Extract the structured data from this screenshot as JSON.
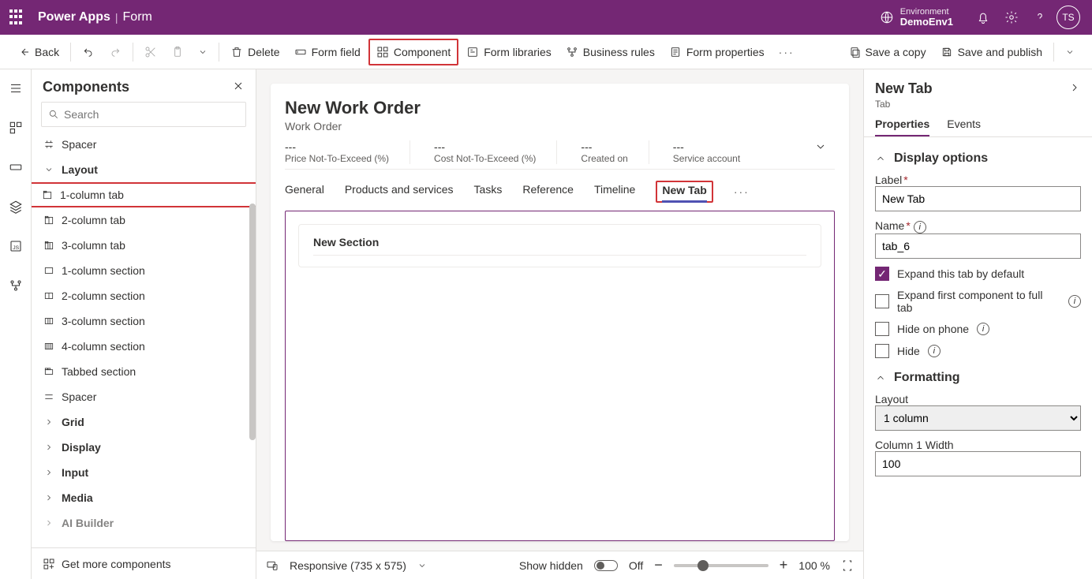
{
  "topbar": {
    "brand": "Power Apps",
    "subbrand": "Form",
    "env_label": "Environment",
    "env_name": "DemoEnv1",
    "avatar": "TS"
  },
  "cmdbar": {
    "back": "Back",
    "delete": "Delete",
    "form_field": "Form field",
    "component": "Component",
    "form_libraries": "Form libraries",
    "business_rules": "Business rules",
    "form_properties": "Form properties",
    "save_copy": "Save a copy",
    "save_publish": "Save and publish"
  },
  "components": {
    "title": "Components",
    "search_placeholder": "Search",
    "footer": "Get more components",
    "items": [
      {
        "label": "Spacer",
        "type": "item"
      },
      {
        "label": "Layout",
        "type": "group"
      },
      {
        "label": "1-column tab",
        "type": "item",
        "highlight": true
      },
      {
        "label": "2-column tab",
        "type": "item"
      },
      {
        "label": "3-column tab",
        "type": "item"
      },
      {
        "label": "1-column section",
        "type": "item"
      },
      {
        "label": "2-column section",
        "type": "item"
      },
      {
        "label": "3-column section",
        "type": "item"
      },
      {
        "label": "4-column section",
        "type": "item"
      },
      {
        "label": "Tabbed section",
        "type": "item"
      },
      {
        "label": "Spacer",
        "type": "item"
      },
      {
        "label": "Grid",
        "type": "group2"
      },
      {
        "label": "Display",
        "type": "group2"
      },
      {
        "label": "Input",
        "type": "group2"
      },
      {
        "label": "Media",
        "type": "group2"
      },
      {
        "label": "AI Builder",
        "type": "group2"
      }
    ]
  },
  "form": {
    "title": "New Work Order",
    "entity": "Work Order",
    "header_fields": [
      {
        "value": "---",
        "label": "Price Not-To-Exceed (%)"
      },
      {
        "value": "---",
        "label": "Cost Not-To-Exceed (%)"
      },
      {
        "value": "---",
        "label": "Created on"
      },
      {
        "value": "---",
        "label": "Service account"
      }
    ],
    "tabs": [
      "General",
      "Products and services",
      "Tasks",
      "Reference",
      "Timeline",
      "New Tab"
    ],
    "section_title": "New Section"
  },
  "canvasbar": {
    "responsive": "Responsive (735 x 575)",
    "show_hidden": "Show hidden",
    "off": "Off",
    "zoom": "100 %"
  },
  "props": {
    "title": "New Tab",
    "sub": "Tab",
    "tabs": [
      "Properties",
      "Events"
    ],
    "display_options": "Display options",
    "label_lbl": "Label",
    "label_val": "New Tab",
    "name_lbl": "Name",
    "name_val": "tab_6",
    "expand_default": "Expand this tab by default",
    "expand_first": "Expand first component to full tab",
    "hide_phone": "Hide on phone",
    "hide": "Hide",
    "formatting": "Formatting",
    "layout_lbl": "Layout",
    "layout_val": "1 column",
    "col1_lbl": "Column 1 Width",
    "col1_val": "100"
  }
}
